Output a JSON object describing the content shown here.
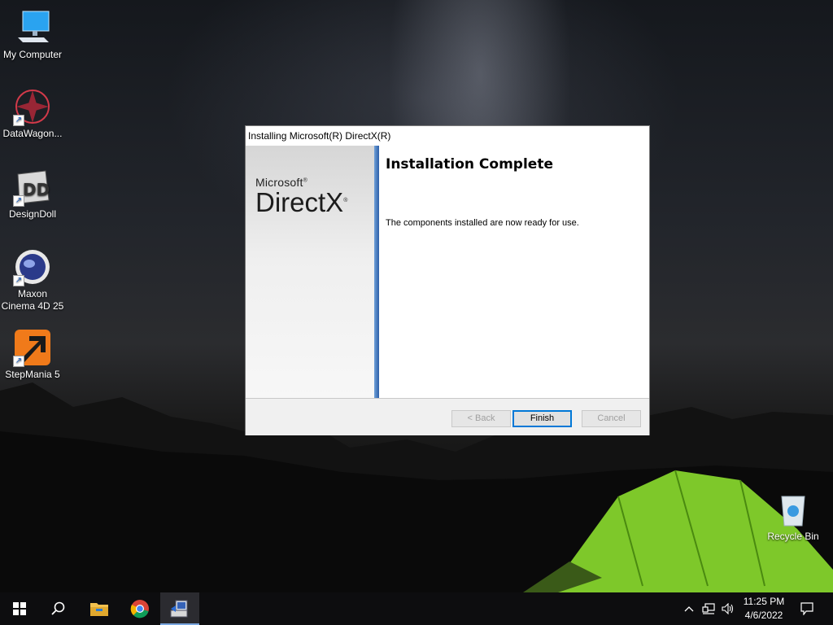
{
  "desktop": {
    "icons": [
      {
        "label": "My Computer",
        "icon": "monitor-icon"
      },
      {
        "label": "DataWagon...",
        "icon": "datawagon-icon"
      },
      {
        "label": "DesignDoll",
        "icon": "designdoll-icon"
      },
      {
        "label": "Maxon Cinema 4D 25",
        "icon": "cinema4d-icon"
      },
      {
        "label": "StepMania 5",
        "icon": "stepmania-icon"
      },
      {
        "label": "Recycle Bin",
        "icon": "recycle-bin-icon"
      }
    ]
  },
  "dialog": {
    "title": "Installing Microsoft(R) DirectX(R)",
    "logo_small": "Microsoft",
    "logo_big": "DirectX",
    "heading": "Installation Complete",
    "message": "The components installed are now ready for use.",
    "buttons": {
      "back": "< Back",
      "finish": "Finish",
      "cancel": "Cancel"
    },
    "accent_color": "#0078d7"
  },
  "taskbar": {
    "items": [
      "start-icon",
      "search-icon",
      "file-explorer-icon",
      "chrome-icon",
      "directx-setup-icon"
    ],
    "clock": {
      "time": "11:25 PM",
      "date": "4/6/2022"
    },
    "tray": [
      "chevron-up-icon",
      "network-icon",
      "volume-icon",
      "notification-icon"
    ]
  }
}
